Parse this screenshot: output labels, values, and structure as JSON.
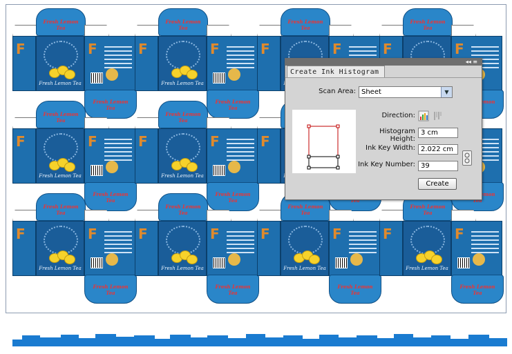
{
  "artwork": {
    "tile_front_name": "Fresh Lemon Tea",
    "tile_tab_name": "Fresh Lemon Tea",
    "brand_letter": "F",
    "colors": {
      "box_blue": "#1a5d99",
      "tab_blue": "#2a86c9",
      "lemon": "#f6d22b",
      "logo_orange": "#e08a2c"
    },
    "grid": {
      "rows": 3,
      "cols": 4
    }
  },
  "dialog": {
    "title": "Create Ink Histogram",
    "controls": "◂◂ ≡",
    "scan_area_label": "Scan Area:",
    "scan_area_value": "Sheet",
    "direction_label": "Direction:",
    "direction_icons": [
      "vertical-bars-icon",
      "horizontal-bars-icon"
    ],
    "histogram_height_label": "Histogram Height:",
    "histogram_height_value": "3 cm",
    "ink_key_width_label": "Ink Key Width:",
    "ink_key_width_value": "2.022 cm",
    "ink_key_number_label": "Ink Key Number:",
    "ink_key_number_value": "39",
    "create_button": "Create"
  }
}
